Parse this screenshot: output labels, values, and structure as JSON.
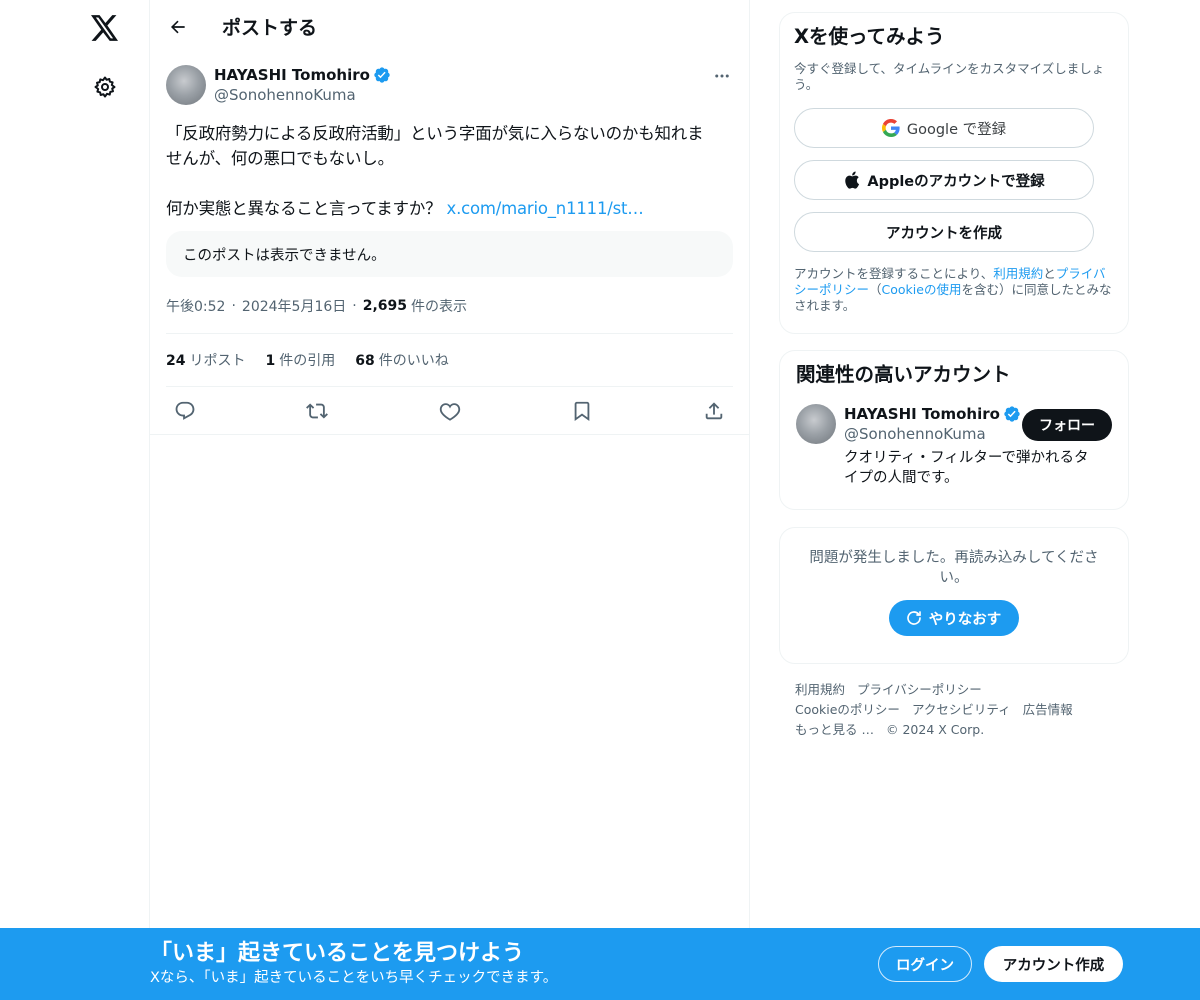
{
  "header": {
    "title": "ポストする"
  },
  "post": {
    "author_name": "HAYASHI Tomohiro",
    "author_handle": "@SonohennoKuma",
    "text_line1": "「反政府勢力による反政府活動」という字面が気に入らないのかも知れま",
    "text_line2": "せんが、何の悪口でもないし。",
    "text_line3": "何か実態と異なること言ってますか？ ",
    "link_text": "x.com/mario_n1111/st…",
    "quoted_unavailable": "このポストは表示できません。",
    "time": "午後0:52",
    "date": "2024年5月16日",
    "views_count": "2,695",
    "views_label": "件の表示",
    "reposts_count": "24",
    "reposts_label": "リポスト",
    "quotes_count": "1",
    "quotes_label": "件の引用",
    "likes_count": "68",
    "likes_label": "件のいいね"
  },
  "signup": {
    "title": "Xを使ってみよう",
    "subtitle": "今すぐ登録して、タイムラインをカスタマイズしましょう。",
    "google_brand": "Google",
    "google_suffix": " で登録",
    "apple_label": "Appleのアカウントで登録",
    "create_label": "アカウントを作成",
    "terms_pre": "アカウントを登録することにより、",
    "terms_link1": "利用規約",
    "terms_and": "と",
    "terms_link2": "プライバシーポリシー",
    "terms_paren_open": "（",
    "terms_link3": "Cookieの使用",
    "terms_post": "を含む）に同意したとみなされます。"
  },
  "related": {
    "title": "関連性の高いアカウント",
    "name": "HAYASHI Tomohiro",
    "handle": "@SonohennoKuma",
    "follow_label": "フォロー",
    "bio": "クオリティ・フィルターで弾かれるタイプの人間です。"
  },
  "error": {
    "message": "問題が発生しました。再読み込みしてください。",
    "retry_label": "やりなおす"
  },
  "footer": {
    "links": [
      "利用規約",
      "プライバシーポリシー",
      "Cookieのポリシー",
      "アクセシビリティ",
      "広告情報",
      "もっと見る …",
      "© 2024 X Corp."
    ]
  },
  "bottombar": {
    "title": "「いま」起きていることを見つけよう",
    "subtitle": "Xなら、「いま」起きていることをいち早くチェックできます。",
    "login_label": "ログイン",
    "signup_label": "アカウント作成"
  },
  "colors": {
    "accent": "#1d9bf0",
    "text": "#0f1419",
    "secondary": "#536471",
    "border": "#eff3f4"
  },
  "icons": [
    "x-logo-icon",
    "gear-icon",
    "back-arrow-icon",
    "verified-badge-icon",
    "more-icon",
    "reply-icon",
    "repost-icon",
    "like-icon",
    "bookmark-icon",
    "share-icon",
    "google-icon",
    "apple-icon",
    "refresh-icon"
  ]
}
